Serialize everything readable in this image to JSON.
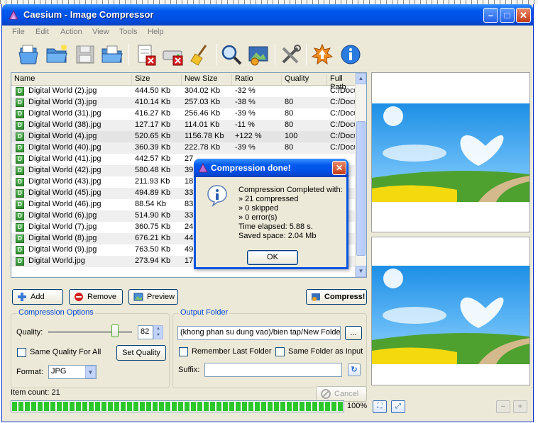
{
  "window": {
    "title": "Caesium - Image Compressor"
  },
  "menu": [
    "File",
    "Edit",
    "Action",
    "View",
    "Tools",
    "Help"
  ],
  "toolbar": [
    "open-file-icon",
    "open-folder-icon",
    "save-icon",
    "export-icon",
    "clear-list-icon",
    "remove-drive-icon",
    "broom-icon",
    "search-icon",
    "image-settings-icon",
    "tools-icon",
    "update-icon",
    "info-icon"
  ],
  "list": {
    "columns": [
      "Name",
      "Size",
      "New Size",
      "Ratio",
      "Quality",
      "Full Path"
    ],
    "rows": [
      {
        "name": "Digital World (2).jpg",
        "size": "444.50 Kb",
        "new": "304.02 Kb",
        "ratio": "-32 %",
        "quality": "",
        "path": "C:/Docu"
      },
      {
        "name": "Digital World (3).jpg",
        "size": "410.14 Kb",
        "new": "257.03 Kb",
        "ratio": "-38 %",
        "quality": "80",
        "path": "C:/Docu"
      },
      {
        "name": "Digital World (31).jpg",
        "size": "416.27 Kb",
        "new": "256.46 Kb",
        "ratio": "-39 %",
        "quality": "80",
        "path": "C:/Docu"
      },
      {
        "name": "Digital World (38).jpg",
        "size": "127.17 Kb",
        "new": "114.01 Kb",
        "ratio": "-11 %",
        "quality": "80",
        "path": "C:/Docu"
      },
      {
        "name": "Digital World (4).jpg",
        "size": "520.65 Kb",
        "new": "1156.78 Kb",
        "ratio": "+122 %",
        "quality": "100",
        "path": "C:/Docu"
      },
      {
        "name": "Digital World (40).jpg",
        "size": "360.39 Kb",
        "new": "222.78 Kb",
        "ratio": "-39 %",
        "quality": "80",
        "path": "C:/Docu"
      },
      {
        "name": "Digital World (41).jpg",
        "size": "442.57 Kb",
        "new": "27",
        "ratio": "",
        "quality": "",
        "path": ""
      },
      {
        "name": "Digital World (42).jpg",
        "size": "580.48 Kb",
        "new": "39",
        "ratio": "",
        "quality": "",
        "path": ""
      },
      {
        "name": "Digital World (43).jpg",
        "size": "211.93 Kb",
        "new": "18",
        "ratio": "",
        "quality": "",
        "path": ""
      },
      {
        "name": "Digital World (45).jpg",
        "size": "494.89 Kb",
        "new": "33",
        "ratio": "",
        "quality": "",
        "path": ""
      },
      {
        "name": "Digital World (46).jpg",
        "size": "88.54 Kb",
        "new": "83",
        "ratio": "",
        "quality": "",
        "path": ""
      },
      {
        "name": "Digital World (6).jpg",
        "size": "514.90 Kb",
        "new": "33",
        "ratio": "",
        "quality": "",
        "path": ""
      },
      {
        "name": "Digital World (7).jpg",
        "size": "360.75 Kb",
        "new": "24",
        "ratio": "",
        "quality": "",
        "path": ""
      },
      {
        "name": "Digital World (8).jpg",
        "size": "676.21 Kb",
        "new": "44",
        "ratio": "",
        "quality": "",
        "path": ""
      },
      {
        "name": "Digital World (9).jpg",
        "size": "763.50 Kb",
        "new": "49",
        "ratio": "",
        "quality": "",
        "path": ""
      },
      {
        "name": "Digital World.jpg",
        "size": "273.94 Kb",
        "new": "17",
        "ratio": "",
        "quality": "",
        "path": ""
      }
    ]
  },
  "buttons": {
    "add": "Add",
    "remove": "Remove",
    "preview": "Preview",
    "compress": "Compress!",
    "set_quality": "Set Quality",
    "browse": "...",
    "cancel": "Cancel"
  },
  "compression": {
    "group_label": "Compression Options",
    "quality_label": "Quality:",
    "quality_value": "82",
    "same_quality_label": "Same Quality For All",
    "format_label": "Format:",
    "format_value": "JPG"
  },
  "output": {
    "group_label": "Output Folder",
    "folder_value": "(khong phan su dung vao)/bien tap/New Folder",
    "remember_label": "Remember Last Folder",
    "same_folder_label": "Same Folder as Input",
    "suffix_label": "Suffix:",
    "suffix_value": ""
  },
  "status": {
    "item_count": "Item count: 21",
    "progress_text": "100%",
    "progress_fraction": 1.0
  },
  "dialog": {
    "title": "Compression done!",
    "lines": [
      "Compression Completed with:",
      "» 21 compressed",
      "» 0 skipped",
      "» 0 error(s)",
      "Time elapsed: 5.88 s.",
      "Saved space: 2.04 Mb"
    ],
    "ok": "OK"
  },
  "colors": {
    "xp_blue": "#0054e3",
    "progress_green": "#2bc72b",
    "group_label": "#0046d5"
  }
}
